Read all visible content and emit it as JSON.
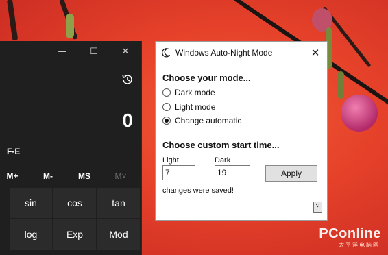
{
  "calculator": {
    "display": "0",
    "fe_label": "F-E",
    "minimize_glyph": "—",
    "maximize_glyph": "☐",
    "close_glyph": "✕",
    "memory": [
      "M+",
      "M-",
      "MS",
      "M˅"
    ],
    "keys": [
      [
        "sin",
        "cos",
        "tan"
      ],
      [
        "log",
        "Exp",
        "Mod"
      ]
    ]
  },
  "dialog": {
    "title": "Windows Auto-Night Mode",
    "close_glyph": "✕",
    "mode_heading": "Choose your mode...",
    "modes": [
      {
        "label": "Dark mode",
        "selected": false
      },
      {
        "label": "Light mode",
        "selected": false
      },
      {
        "label": "Change automatic",
        "selected": true
      }
    ],
    "time_heading": "Choose custom start time...",
    "light_label": "Light",
    "light_value": "7",
    "dark_label": "Dark",
    "dark_value": "19",
    "apply_label": "Apply",
    "status": "changes were saved!",
    "help_label": "?"
  },
  "watermark": {
    "brand": "PConline",
    "sub": "太平洋电脑网"
  },
  "icons": {
    "moon": "moon-icon",
    "history": "history-icon"
  }
}
